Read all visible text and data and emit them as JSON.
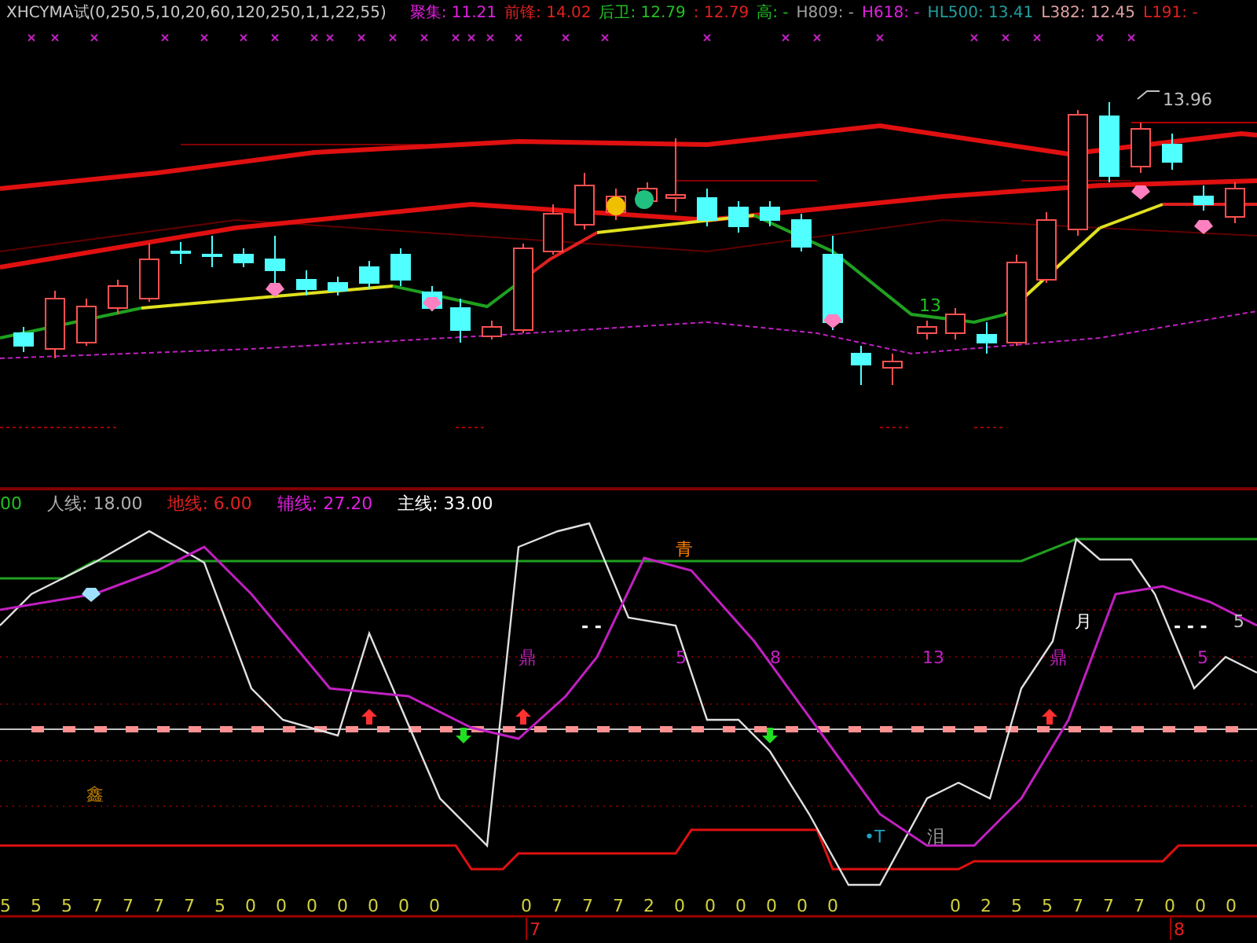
{
  "header": {
    "indicator": "XHCYMA试(0,250,5,10,20,60,120,250,1,1,22,55)",
    "fields": [
      {
        "text": "聚集: 11.21",
        "color": "#e020e0"
      },
      {
        "text": "前锋: 14.02",
        "color": "#e02020"
      },
      {
        "text": "后卫: 12.79",
        "color": "#20c020"
      },
      {
        "text": ": 12.79",
        "color": "#e02020"
      },
      {
        "text": "高: -",
        "color": "#20c020"
      },
      {
        "text": "H809: -",
        "color": "#a0a0a0"
      },
      {
        "text": "H618: -",
        "color": "#e020e0"
      },
      {
        "text": "HL500: 13.41",
        "color": "#20a0a0"
      },
      {
        "text": "L382: 12.45",
        "color": "#e0a0a0"
      },
      {
        "text": "L191: -",
        "color": "#e02020"
      }
    ]
  },
  "price_chart": {
    "labels": [
      "13.96",
      "13"
    ]
  },
  "oscillator": {
    "legend": [
      {
        "text": "00",
        "color": "#20c020"
      },
      {
        "text": "人线: 18.00",
        "color": "#b0b0b0"
      },
      {
        "text": "地线: 6.00",
        "color": "#e02020"
      },
      {
        "text": "辅线: 27.20",
        "color": "#e020e0"
      },
      {
        "text": "主线: 33.00",
        "color": "#ffffff"
      }
    ],
    "labels": [
      {
        "text": "青",
        "color": "#ff8000"
      },
      {
        "text": "- -",
        "color": "#ffffff"
      },
      {
        "text": "鼎",
        "color": "#c020c0"
      },
      {
        "text": "5",
        "color": "#c020c0"
      },
      {
        "text": "8",
        "color": "#c020c0"
      },
      {
        "text": "13",
        "color": "#c020c0"
      },
      {
        "text": "月",
        "color": "#ffffff"
      },
      {
        "text": "- - -",
        "color": "#ffffff"
      },
      {
        "text": "5",
        "color": "#c0c0c0"
      },
      {
        "text": "鼎",
        "color": "#c020c0"
      },
      {
        "text": "5",
        "color": "#c020c0"
      },
      {
        "text": "鑫",
        "color": "#c08000"
      },
      {
        "text": "•T",
        "color": "#20a0c0"
      },
      {
        "text": "泪",
        "color": "#a0a0a0"
      }
    ]
  },
  "axis": {
    "digit_groups": [
      {
        "digits": [
          "5",
          "5",
          "5",
          "7",
          "7",
          "7",
          "7",
          "5",
          "0",
          "0",
          "0",
          "0",
          "0",
          "0",
          "0"
        ]
      },
      {
        "digits": [
          "0",
          "7",
          "7",
          "7",
          "2",
          "0",
          "0",
          "0",
          "0",
          "0",
          "0"
        ]
      },
      {
        "digits": [
          "0",
          "2",
          "5",
          "5",
          "7",
          "7",
          "7",
          "0",
          "0",
          "0"
        ]
      }
    ],
    "date_marks": [
      "7",
      "8"
    ]
  }
}
